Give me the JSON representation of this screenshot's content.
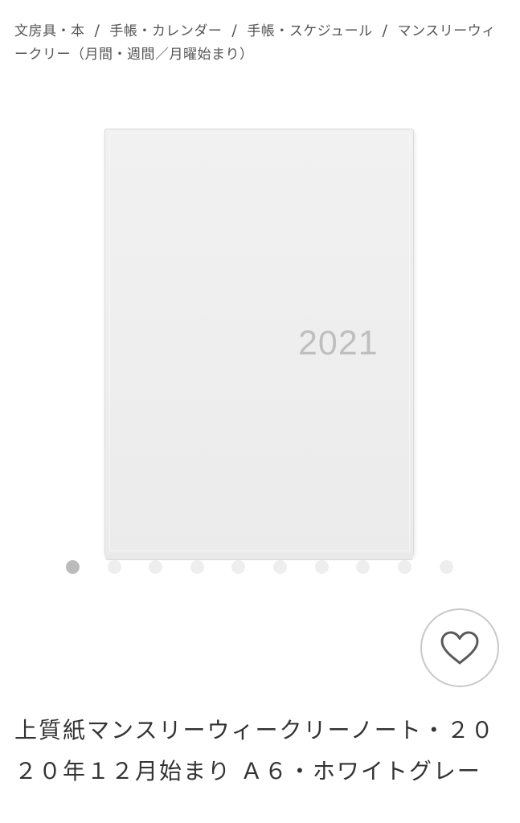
{
  "breadcrumb": {
    "items": [
      {
        "label": "文房具・本"
      },
      {
        "label": "手帳・カレンダー"
      },
      {
        "label": "手帳・スケジュール"
      },
      {
        "label": "マンスリーウィークリー（月間・週間／月曜始まり）"
      }
    ],
    "separator": "/"
  },
  "product": {
    "cover_text": "2021",
    "title": "上質紙マンスリーウィークリーノート・２０２０年１２月始まり Ａ６・ホワイトグレー"
  },
  "carousel": {
    "total": 10,
    "active_index": 0
  },
  "favorite": {
    "icon": "heart-icon"
  },
  "colors": {
    "text": "#333333",
    "dot_active": "#bbbbbb",
    "dot_inactive": "#eeeeee",
    "fav_border": "#c8c8c8"
  }
}
